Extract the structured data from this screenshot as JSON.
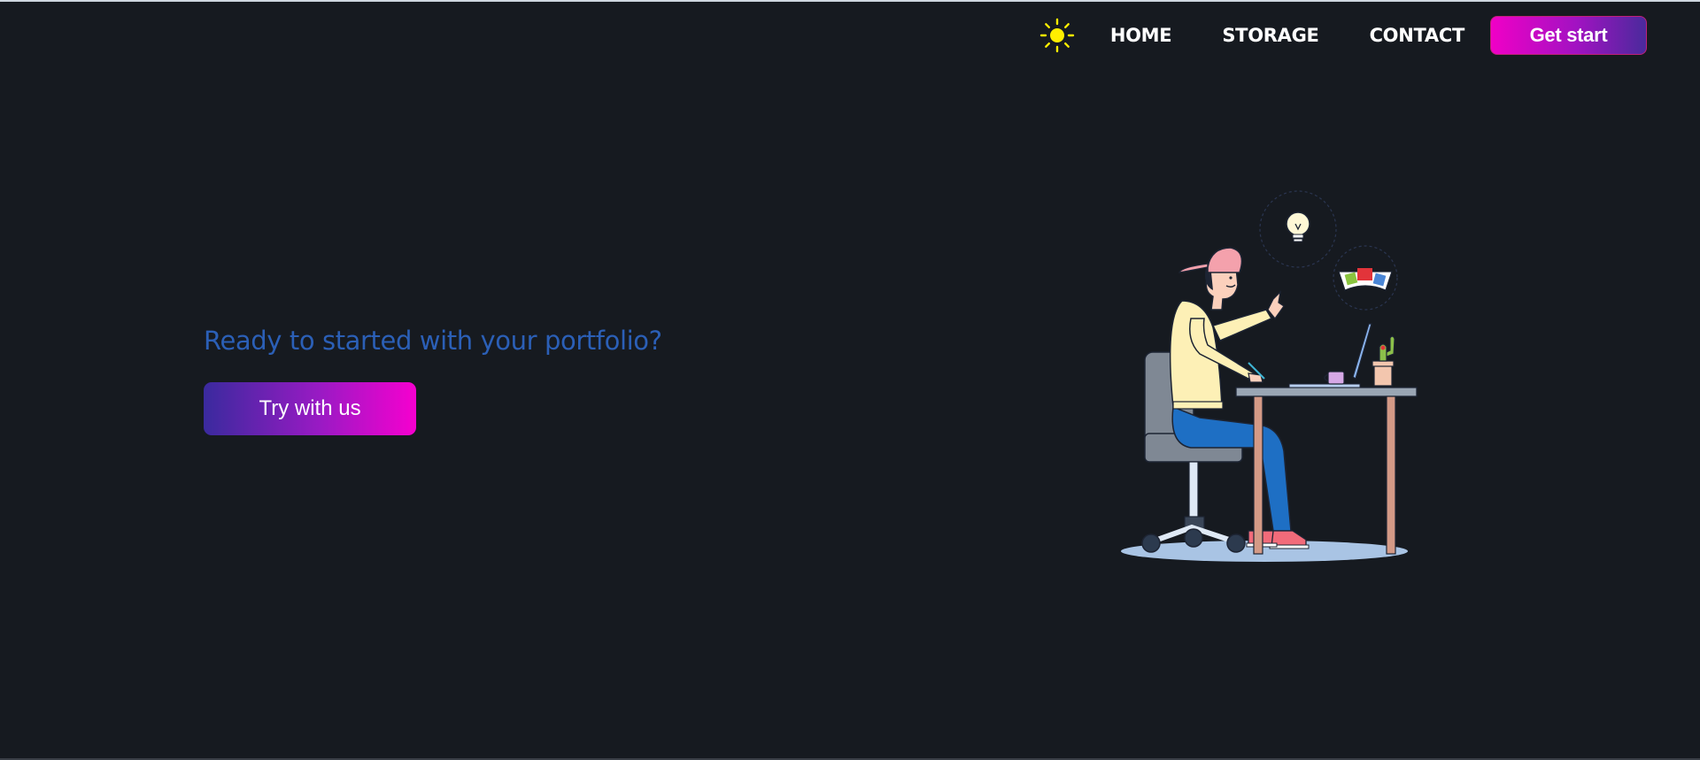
{
  "nav": {
    "theme_icon": "sun-icon",
    "links": [
      {
        "label": "HOME"
      },
      {
        "label": "STORAGE"
      },
      {
        "label": "CONTACT"
      }
    ],
    "cta_label": "Get start"
  },
  "hero": {
    "heading": "Ready to started with your portfolio?",
    "button_label": "Try with us",
    "illustration": "person-working-at-desk-illustration"
  },
  "colors": {
    "background": "#161a20",
    "heading": "#2b5fb6",
    "accent_pink": "#f000c6",
    "accent_purple": "#4a2a9c",
    "sun": "#ffee00"
  }
}
